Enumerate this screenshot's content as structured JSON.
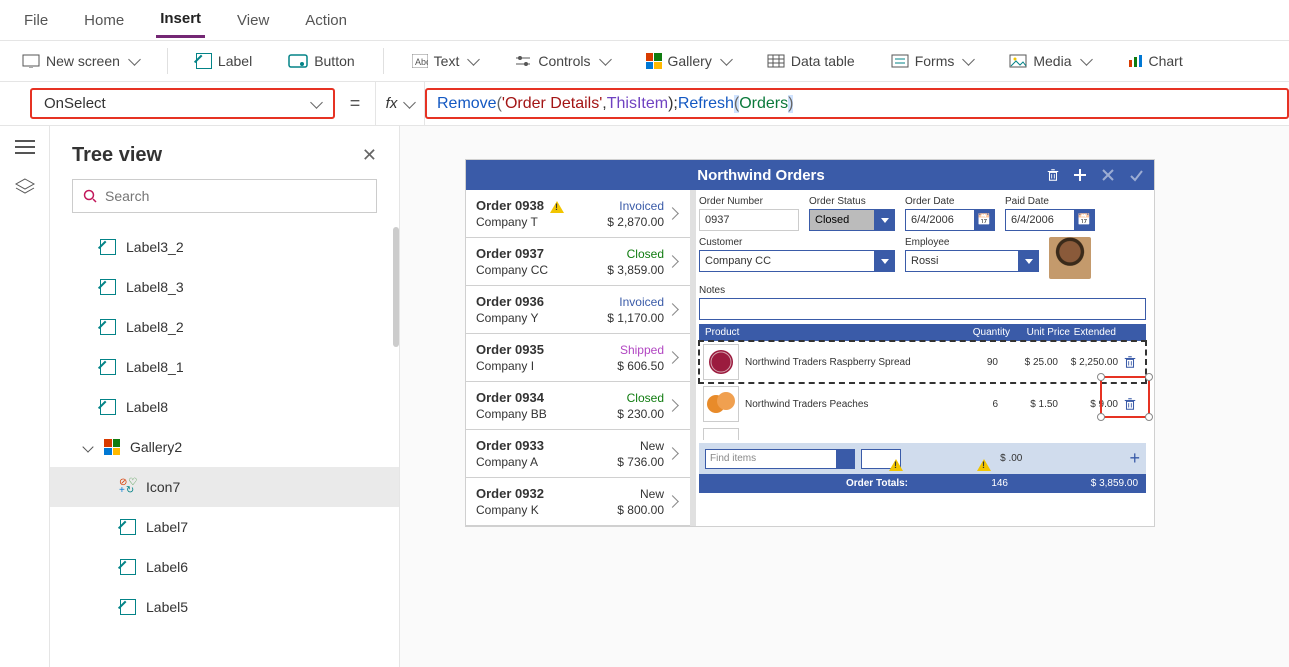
{
  "menu": {
    "items": [
      "File",
      "Home",
      "Insert",
      "View",
      "Action"
    ],
    "active": "Insert"
  },
  "ribbon": {
    "new_screen": "New screen",
    "label": "Label",
    "button": "Button",
    "text": "Text",
    "controls": "Controls",
    "gallery": "Gallery",
    "data_table": "Data table",
    "forms": "Forms",
    "media": "Media",
    "chart": "Chart"
  },
  "formula": {
    "property": "OnSelect",
    "fx": "fx",
    "tokens": {
      "remove": "Remove",
      "lp1": "( ",
      "target": "'Order Details'",
      "comma1": ", ",
      "this": "ThisItem",
      "rp1": " ); ",
      "refresh": "Refresh",
      "lp2": "( ",
      "src": "Orders",
      "rp2": " )"
    }
  },
  "tree": {
    "title": "Tree view",
    "search_placeholder": "Search",
    "items": [
      {
        "label": "Label3_2",
        "type": "label",
        "level": 2
      },
      {
        "label": "Label8_3",
        "type": "label",
        "level": 2
      },
      {
        "label": "Label8_2",
        "type": "label",
        "level": 2
      },
      {
        "label": "Label8_1",
        "type": "label",
        "level": 2
      },
      {
        "label": "Label8",
        "type": "label",
        "level": 2
      },
      {
        "label": "Gallery2",
        "type": "gallery",
        "level": 2,
        "expanded": true
      },
      {
        "label": "Icon7",
        "type": "icon",
        "level": 3,
        "selected": true
      },
      {
        "label": "Label7",
        "type": "label",
        "level": 3
      },
      {
        "label": "Label6",
        "type": "label",
        "level": 3
      },
      {
        "label": "Label5",
        "type": "label",
        "level": 3
      }
    ]
  },
  "app": {
    "title": "Northwind Orders",
    "orders": [
      {
        "no": "Order 0938",
        "company": "Company T",
        "status": "Invoiced",
        "status_class": "c-invoiced",
        "amount": "$ 2,870.00",
        "warn": true
      },
      {
        "no": "Order 0937",
        "company": "Company CC",
        "status": "Closed",
        "status_class": "c-closed",
        "amount": "$ 3,859.00"
      },
      {
        "no": "Order 0936",
        "company": "Company Y",
        "status": "Invoiced",
        "status_class": "c-invoiced",
        "amount": "$ 1,170.00"
      },
      {
        "no": "Order 0935",
        "company": "Company I",
        "status": "Shipped",
        "status_class": "c-shipped",
        "amount": "$ 606.50"
      },
      {
        "no": "Order 0934",
        "company": "Company BB",
        "status": "Closed",
        "status_class": "c-closed",
        "amount": "$ 230.00"
      },
      {
        "no": "Order 0933",
        "company": "Company A",
        "status": "New",
        "status_class": "c-new",
        "amount": "$ 736.00"
      },
      {
        "no": "Order 0932",
        "company": "Company K",
        "status": "New",
        "status_class": "c-new",
        "amount": "$ 800.00"
      }
    ],
    "detail": {
      "order_number_label": "Order Number",
      "order_number": "0937",
      "order_status_label": "Order Status",
      "order_status": "Closed",
      "order_date_label": "Order Date",
      "order_date": "6/4/2006",
      "paid_date_label": "Paid Date",
      "paid_date": "6/4/2006",
      "customer_label": "Customer",
      "customer": "Company CC",
      "employee_label": "Employee",
      "employee": "Rossi",
      "notes_label": "Notes"
    },
    "line_headers": {
      "product": "Product",
      "quantity": "Quantity",
      "unit_price": "Unit Price",
      "extended": "Extended"
    },
    "lines": [
      {
        "product": "Northwind Traders Raspberry Spread",
        "qty": "90",
        "unit_price": "$ 25.00",
        "extended": "$ 2,250.00",
        "thumb_color": "#9b1b3e",
        "selected": true
      },
      {
        "product": "Northwind Traders Peaches",
        "qty": "6",
        "unit_price": "$ 1.50",
        "extended": "$ 9.00",
        "thumb_color": "#e88b2a"
      }
    ],
    "add": {
      "placeholder": "Find items",
      "ext": "$ .00"
    },
    "totals": {
      "label": "Order Totals:",
      "qty": "146",
      "amount": "$ 3,859.00"
    }
  }
}
